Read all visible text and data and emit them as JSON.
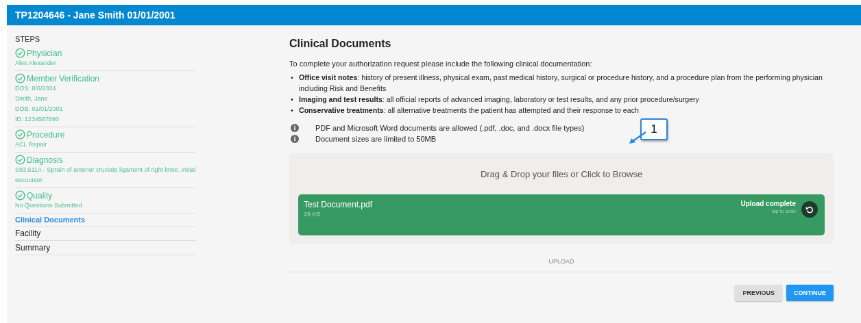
{
  "header": {
    "title": "TP1204646 - Jane Smith 01/01/2001"
  },
  "steps": {
    "heading": "STEPS",
    "items": [
      {
        "label": "Physician",
        "completed": true,
        "selected": false,
        "details": [
          "Alex Alexander"
        ]
      },
      {
        "label": "Member Verification",
        "completed": true,
        "selected": false,
        "details": [
          "DOS: 8/6/2024",
          "Smith, Jane",
          "DOB: 01/01/2001",
          "ID: 1234567890"
        ]
      },
      {
        "label": "Procedure",
        "completed": true,
        "selected": false,
        "details": [
          "ACL Repair"
        ]
      },
      {
        "label": "Diagnosis",
        "completed": true,
        "selected": false,
        "details": [
          "S83.511A - Sprain of anterior cruciate ligament of right knee, initial encounter"
        ]
      },
      {
        "label": "Quality",
        "completed": true,
        "selected": false,
        "details": [
          "No Questions Submitted"
        ]
      },
      {
        "label": "Clinical Documents",
        "completed": false,
        "selected": true
      },
      {
        "label": "Facility",
        "completed": false,
        "selected": false
      },
      {
        "label": "Summary",
        "completed": false,
        "selected": false
      }
    ]
  },
  "main": {
    "title": "Clinical Documents",
    "intro": "To complete your authorization request please include the following clinical documentation:",
    "requirements": [
      {
        "bullet": "•",
        "text": "**Office visit notes**: history of present illness, physical exam, past medical history, surgical or procedure history, and a procedure plan from the performing physician including Risk and Benefits"
      },
      {
        "bullet": "•",
        "text": "**Imaging and test results**: all official reports of advanced imaging, laboratory or test results, and any prior procedure/surgery"
      },
      {
        "bullet": "•",
        "text": "**Conservative treatments**: all alternative treatments the patient has attempted and their response to each"
      }
    ],
    "notes": [
      "PDF and Microsoft Word documents are allowed (.pdf, .doc, and .docx file types)",
      "Document sizes are limited to 50MB"
    ],
    "dropzone": {
      "prompt": "Drag & Drop your files or Click to Browse",
      "files": [
        {
          "name": "Test Document.pdf",
          "size": "29 KB",
          "status": "Upload complete",
          "hint": "tap to undo"
        }
      ]
    },
    "upload_button": {
      "label": "UPLOAD",
      "disabled": true
    },
    "buttons": [
      {
        "label": "PREVIOUS",
        "kind": "secondary"
      },
      {
        "label": "CONTINUE",
        "kind": "primary"
      }
    ]
  },
  "callout": {
    "label": "1"
  }
}
